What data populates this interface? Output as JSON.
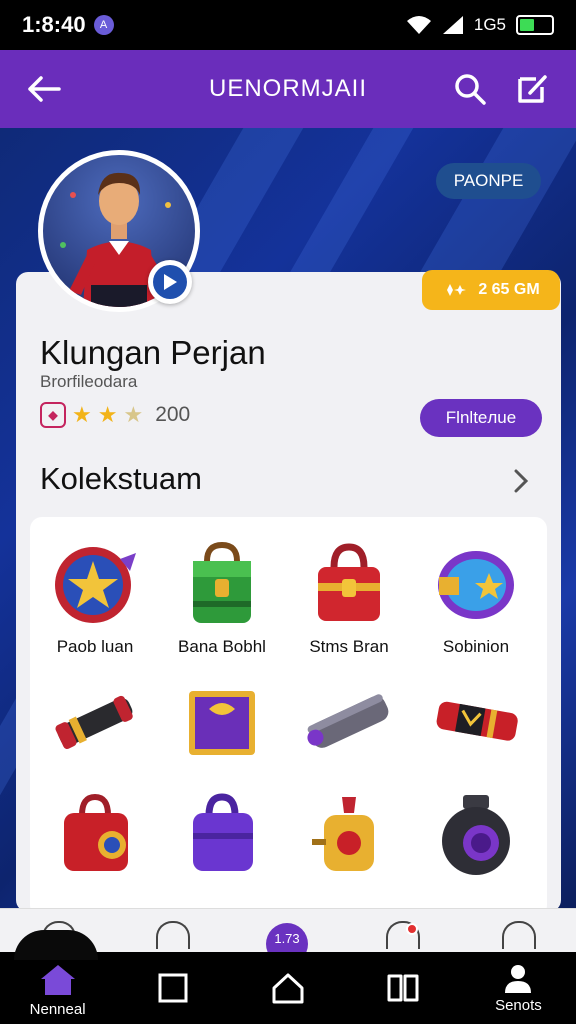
{
  "status": {
    "time": "1:8:40",
    "notif_glyph": "A",
    "net": "1G5"
  },
  "appbar": {
    "title": "UENORMJAII"
  },
  "profile": {
    "badge": "PAONPE",
    "coins": "2 65 GM",
    "name": "Klungan Perjan",
    "subtitle": "Brorfileodara",
    "rating_value": "200",
    "rating_stars": 2.5,
    "action_label": "Flnlteлue"
  },
  "collection": {
    "title": "Kolekstuam",
    "items": [
      {
        "label": "Paob luan",
        "icon": "shield-star-icon"
      },
      {
        "label": "Bana Bobhl",
        "icon": "green-chest-icon"
      },
      {
        "label": "Stms Bran",
        "icon": "red-chest-icon"
      },
      {
        "label": "Sobinion",
        "icon": "purple-drum-icon"
      },
      {
        "label": "",
        "icon": "black-cannon-icon"
      },
      {
        "label": "",
        "icon": "purple-box-icon"
      },
      {
        "label": "",
        "icon": "steel-cannon-icon"
      },
      {
        "label": "",
        "icon": "red-cannon-icon"
      },
      {
        "label": "",
        "icon": "red-lockbox-icon"
      },
      {
        "label": "",
        "icon": "purple-lockbox-icon"
      },
      {
        "label": "",
        "icon": "gold-potion-icon"
      },
      {
        "label": "",
        "icon": "black-orb-icon"
      }
    ]
  },
  "nav_top": {
    "center_label": "1.73"
  },
  "nav": {
    "items": [
      {
        "label": "Nenneal",
        "icon": "home-icon",
        "active": true
      },
      {
        "label": "",
        "icon": "square-icon"
      },
      {
        "label": "",
        "icon": "house-outline-icon"
      },
      {
        "label": "",
        "icon": "book-icon"
      },
      {
        "label": "Senots",
        "icon": "person-icon"
      }
    ]
  },
  "colors": {
    "appbar": "#6a2dbb",
    "accent": "#6a32c0",
    "coin": "#f5b51a",
    "background": "#0c1f5c"
  }
}
